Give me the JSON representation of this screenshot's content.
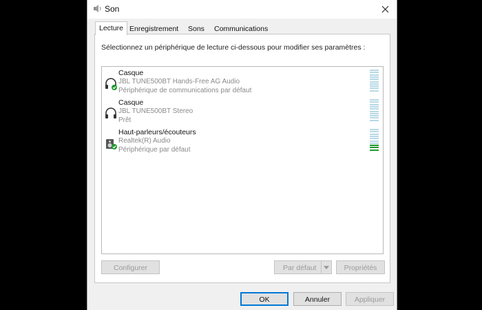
{
  "window": {
    "title": "Son",
    "icon": "speaker-icon",
    "close_icon": "close-icon"
  },
  "tabs": [
    {
      "label": "Lecture",
      "active": true
    },
    {
      "label": "Enregistrement",
      "active": false
    },
    {
      "label": "Sons",
      "active": false
    },
    {
      "label": "Communications",
      "active": false
    }
  ],
  "instruction": "Sélectionnez un périphérique de lecture ci-dessous pour modifier ses paramètres :",
  "devices": [
    {
      "name": "Casque",
      "description": "JBL TUNE500BT Hands-Free AG Audio",
      "status": "Périphérique de communications par défaut",
      "icon": "headset-icon",
      "badge": "default-check-icon",
      "level": 0
    },
    {
      "name": "Casque",
      "description": "JBL TUNE500BT Stereo",
      "status": "Prêt",
      "icon": "headset-icon",
      "badge": "",
      "level": 0
    },
    {
      "name": "Haut-parleurs/écouteurs",
      "description": "Realtek(R) Audio",
      "status": "Périphérique par défaut",
      "icon": "speaker-device-icon",
      "badge": "default-check-icon",
      "level": 0.3
    }
  ],
  "buttons": {
    "configure": "Configurer",
    "set_default": "Par défaut",
    "properties": "Propriétés",
    "ok": "OK",
    "cancel": "Annuler",
    "apply": "Appliquer"
  },
  "colors": {
    "accent": "#0078d7",
    "meter_idle": "#b7d9e6",
    "meter_active": "#1f9a2e",
    "check_badge": "#1f9a2e"
  }
}
